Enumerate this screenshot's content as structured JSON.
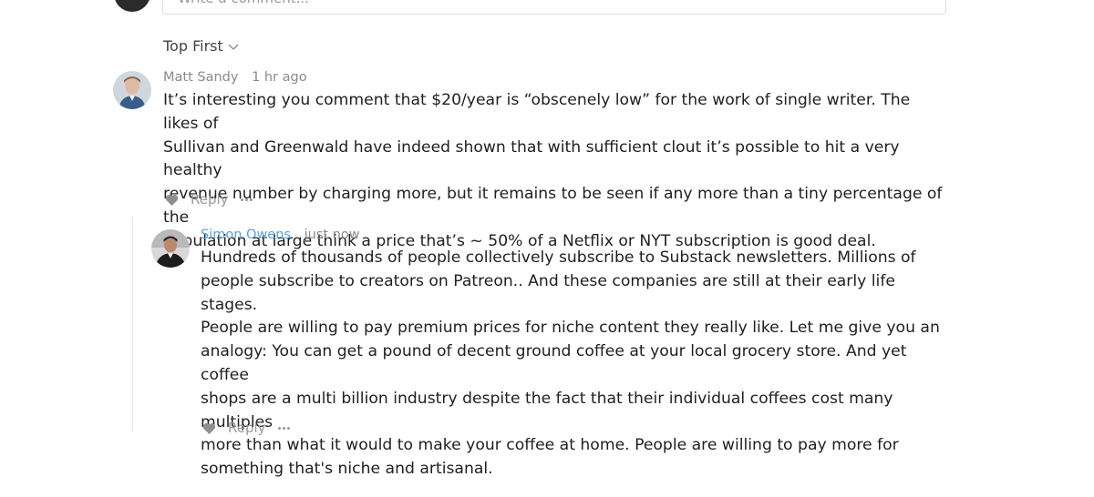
{
  "composer": {
    "placeholder": "Write a comment..."
  },
  "sort": {
    "label": "Top First"
  },
  "comments": [
    {
      "author": "Matt Sandy",
      "time": "1 hr ago",
      "text": "It’s interesting you comment that $20/year is “obscenely low” for the work of single writer. The likes of\nSullivan and Greenwald have indeed shown that with sufficient clout it’s possible to hit a very healthy\nrevenue number by charging more, but it remains to be seen if any more than a tiny percentage of the\npopulation at large think a price that’s ~ 50% of a Netflix or NYT subscription is good deal.",
      "reply_label": "Reply"
    },
    {
      "author": "Simon Owens",
      "time": "just now",
      "text": "Hundreds of thousands of people collectively subscribe to Substack newsletters. Millions of\npeople subscribe to creators on Patreon.. And these companies are still at their early life stages.\nPeople are willing to pay premium prices for niche content they really like. Let me give you an\nanalogy: You can get a pound of decent ground coffee at your local grocery store. And yet coffee\nshops are a multi billion industry despite the fact that their individual coffees cost many multiples\nmore than what it would to make your coffee at home. People are willing to pay more for\nsomething that's niche and artisanal.",
      "reply_label": "Reply"
    }
  ],
  "colors": {
    "author_highlight": "#5aa0d8",
    "muted": "#8a8a8a"
  }
}
